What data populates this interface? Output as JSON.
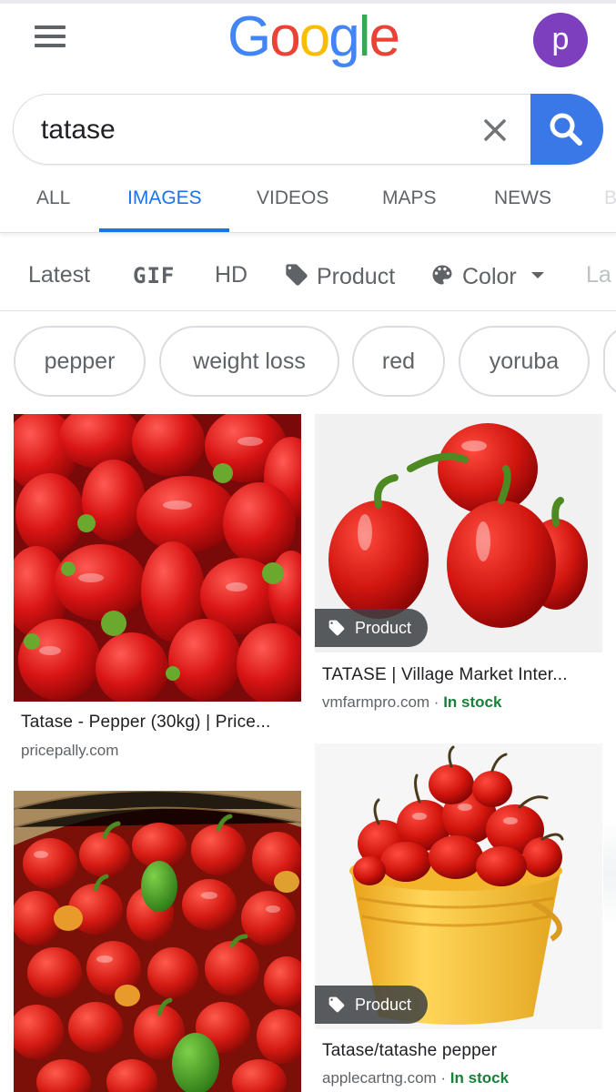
{
  "header": {
    "logo": "Google",
    "avatar_letter": "p"
  },
  "search": {
    "query": "tatase"
  },
  "tabs": [
    {
      "label": "ALL"
    },
    {
      "label": "IMAGES"
    },
    {
      "label": "VIDEOS"
    },
    {
      "label": "MAPS"
    },
    {
      "label": "NEWS"
    },
    {
      "label": "B"
    }
  ],
  "filters": [
    {
      "label": "Latest"
    },
    {
      "label": "GIF"
    },
    {
      "label": "HD"
    },
    {
      "label": "Product"
    },
    {
      "label": "Color"
    },
    {
      "label": "La"
    }
  ],
  "chips": [
    {
      "label": "pepper"
    },
    {
      "label": "weight loss"
    },
    {
      "label": "red"
    },
    {
      "label": "yoruba"
    }
  ],
  "results": [
    {
      "title": "Tatase - Pepper (30kg) | Price...",
      "source": "pricepally.com",
      "stock": ""
    },
    {
      "title": "TATASE | Village Market Inter...",
      "source": "vmfarmpro.com · ",
      "stock": "In stock",
      "badge": "Product"
    },
    {
      "title": "",
      "source": "",
      "stock": ""
    },
    {
      "title": "Tatase/tatashe pepper",
      "source": "applecartng.com · ",
      "stock": "In stock",
      "badge": "Product"
    }
  ],
  "colors": {
    "accent": "#1a73e8",
    "search_button": "#3b78e7",
    "avatar": "#7e3fbf",
    "in_stock": "#188038"
  },
  "icons": [
    "menu-icon",
    "clear-icon",
    "search-icon",
    "tag-icon",
    "palette-icon",
    "caret-down-icon"
  ]
}
